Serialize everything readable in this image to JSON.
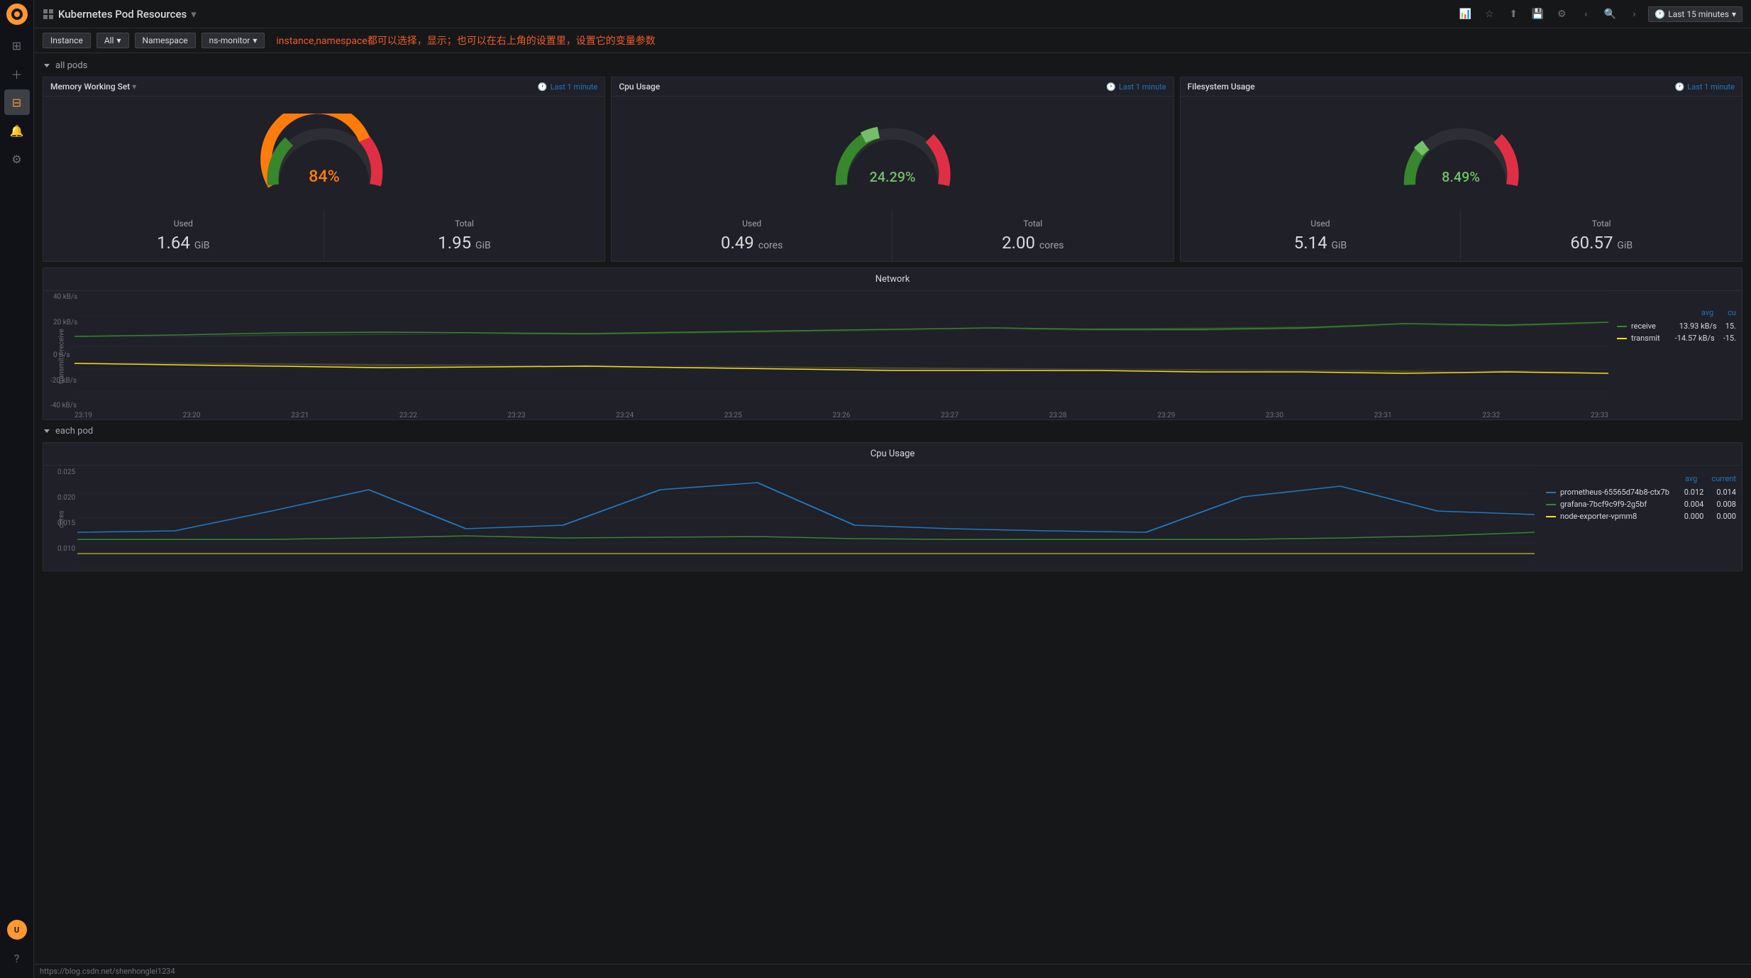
{
  "sidebar": {
    "logo": "grafana-logo",
    "items": [
      {
        "id": "search",
        "icon": "⊞",
        "label": "Search"
      },
      {
        "id": "plus",
        "icon": "+",
        "label": "Add"
      },
      {
        "id": "dashboards",
        "icon": "⊟",
        "label": "Dashboards",
        "active": true
      },
      {
        "id": "alerts",
        "icon": "🔔",
        "label": "Alerts"
      },
      {
        "id": "settings",
        "icon": "⚙",
        "label": "Settings"
      }
    ],
    "bottom_items": [
      {
        "id": "user",
        "icon": "👤",
        "label": "User"
      },
      {
        "id": "help",
        "icon": "?",
        "label": "Help"
      }
    ]
  },
  "topbar": {
    "title": "Kubernetes Pod Resources",
    "dropdown_icon": "▾",
    "actions": [
      "graph-icon",
      "star-icon",
      "share-icon",
      "save-icon",
      "settings-icon"
    ],
    "nav": [
      "back",
      "zoom-in",
      "forward"
    ],
    "time_range": "Last 15 minutes"
  },
  "filterbar": {
    "instance_label": "Instance",
    "instance_value": "All",
    "namespace_label": "Namespace",
    "namespace_value": "ns-monitor",
    "annotation": "instance,namespace都可以选择，显示；也可以在右上角的设置里，设置它的变量参数"
  },
  "sections": {
    "all_pods": {
      "label": "all pods",
      "collapsed": false,
      "memory_panel": {
        "title": "Memory Working Set",
        "time": "Last 1 minute",
        "percent": "84%",
        "percent_color": "#ff7c0a",
        "gauge_value": 84,
        "used_label": "Used",
        "used_value": "1.64",
        "used_unit": "GiB",
        "total_label": "Total",
        "total_value": "1.95",
        "total_unit": "GiB"
      },
      "cpu_panel": {
        "title": "Cpu Usage",
        "time": "Last 1 minute",
        "percent": "24.29%",
        "percent_color": "#73bf69",
        "gauge_value": 24.29,
        "used_label": "Used",
        "used_value": "0.49",
        "used_unit": "cores",
        "total_label": "Total",
        "total_value": "2.00",
        "total_unit": "cores"
      },
      "filesystem_panel": {
        "title": "Filesystem Usage",
        "time": "Last 1 minute",
        "percent": "8.49%",
        "percent_color": "#73bf69",
        "gauge_value": 8.49,
        "used_label": "Used",
        "used_value": "5.14",
        "used_unit": "GiB",
        "total_label": "Total",
        "total_value": "60.57",
        "total_unit": "GiB"
      }
    },
    "network": {
      "title": "Network",
      "y_label": "transmit / receive",
      "y_ticks": [
        "40 kB/s",
        "20 kB/s",
        "0 B/s",
        "-20 kB/s",
        "-40 kB/s"
      ],
      "x_ticks": [
        "23:19",
        "23:20",
        "23:21",
        "23:22",
        "23:23",
        "23:24",
        "23:25",
        "23:26",
        "23:27",
        "23:28",
        "23:29",
        "23:30",
        "23:31",
        "23:32",
        "23:33"
      ],
      "legend": {
        "avg_label": "avg",
        "current_label": "cu",
        "items": [
          {
            "color": "#37872d",
            "label": "receive",
            "avg": "13.93 kB/s",
            "current": "15."
          },
          {
            "color": "#fade2a",
            "label": "transmit",
            "avg": "-14.57 kB/s",
            "current": "-15."
          }
        ]
      }
    },
    "each_pod": {
      "label": "each pod",
      "collapsed": false,
      "cpu_chart": {
        "title": "Cpu Usage",
        "y_ticks": [
          "0.025",
          "0.020",
          "0.015",
          "0.010"
        ],
        "y_label": "cores",
        "legend": {
          "items": [
            {
              "color": "#1f78c1",
              "label": "prometheus-65565d74b8-ctx7b",
              "avg": "0.012",
              "current": "0.014"
            },
            {
              "color": "#37872d",
              "label": "grafana-7bcf9c9f9-2g5bf",
              "avg": "0.004",
              "current": "0.008"
            },
            {
              "color": "#fade2a",
              "label": "node-exporter-vpmm8",
              "avg": "0.000",
              "current": "0.000"
            }
          ]
        }
      }
    }
  },
  "statusbar": {
    "url": "https://blog.csdn.net/shenhonglei1234"
  }
}
